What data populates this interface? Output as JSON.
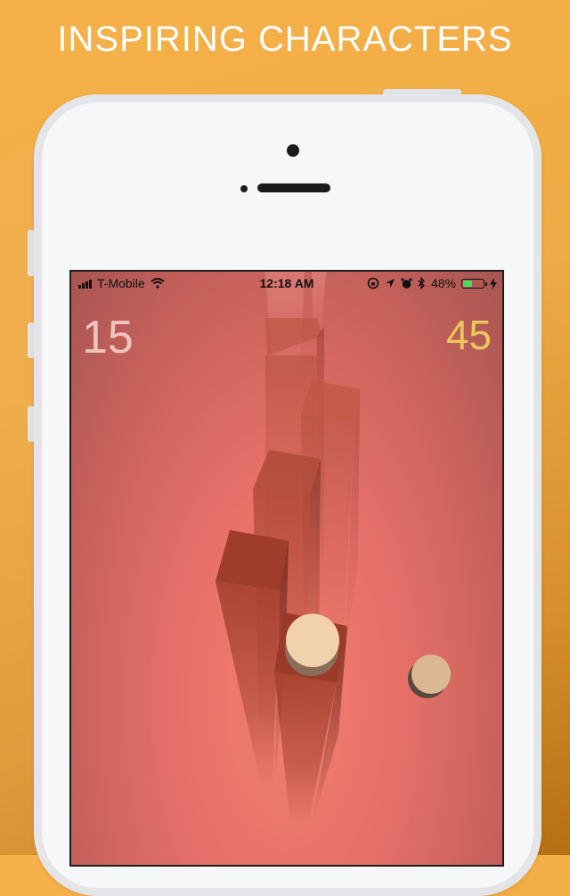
{
  "banner": {
    "title": "INSPIRING CHARACTERS"
  },
  "status_bar": {
    "carrier": "T-Mobile",
    "time": "12:18 AM",
    "battery_percent": "48%",
    "battery_level": 0.48,
    "icons": [
      "signal-icon",
      "wifi-icon",
      "orientation-lock-icon",
      "location-icon",
      "alarm-icon",
      "bluetooth-icon",
      "battery-icon",
      "charging-icon"
    ]
  },
  "game": {
    "score_left": "15",
    "score_right": "45",
    "colors": {
      "background": "#e8716a",
      "pillar": "#b3493a",
      "ball": "#f2d2ac",
      "score_right": "#e7c85a"
    }
  }
}
